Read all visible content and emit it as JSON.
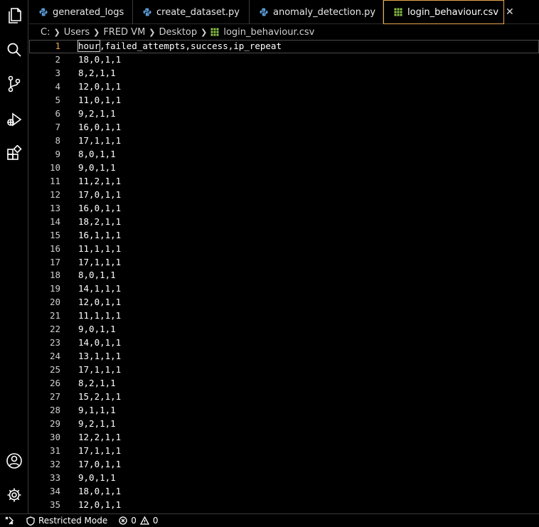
{
  "tabs": [
    {
      "label": "generated_logs",
      "icon": "python-icon",
      "active": false
    },
    {
      "label": "create_dataset.py",
      "icon": "python-icon",
      "active": false
    },
    {
      "label": "anomaly_detection.py",
      "icon": "python-icon",
      "active": false
    },
    {
      "label": "login_behaviour.csv",
      "icon": "csv-table-icon",
      "active": true
    }
  ],
  "tab_close_symbol": "✕",
  "breadcrumb": {
    "parts": [
      "C:",
      "Users",
      "FRED VM",
      "Desktop",
      "login_behaviour.csv"
    ]
  },
  "editor": {
    "current_line": 1,
    "lines": [
      "hour,failed_attempts,success,ip_repeat",
      "18,0,1,1",
      "8,2,1,1",
      "12,0,1,1",
      "11,0,1,1",
      "9,2,1,1",
      "16,0,1,1",
      "17,1,1,1",
      "8,0,1,1",
      "9,0,1,1",
      "11,2,1,1",
      "17,0,1,1",
      "16,0,1,1",
      "18,2,1,1",
      "16,1,1,1",
      "11,1,1,1",
      "17,1,1,1",
      "8,0,1,1",
      "14,1,1,1",
      "12,0,1,1",
      "11,1,1,1",
      "9,0,1,1",
      "14,0,1,1",
      "13,1,1,1",
      "17,1,1,1",
      "8,2,1,1",
      "15,2,1,1",
      "9,1,1,1",
      "9,2,1,1",
      "12,2,1,1",
      "17,1,1,1",
      "17,0,1,1",
      "9,0,1,1",
      "18,0,1,1",
      "12,0,1,1"
    ]
  },
  "status": {
    "restricted_mode": "Restricted Mode",
    "errors": "0",
    "warnings": "0"
  },
  "colors": {
    "accent": "#e8a74b",
    "python_blue": "#5b9bd5",
    "csv_green": "#8bc34a"
  }
}
